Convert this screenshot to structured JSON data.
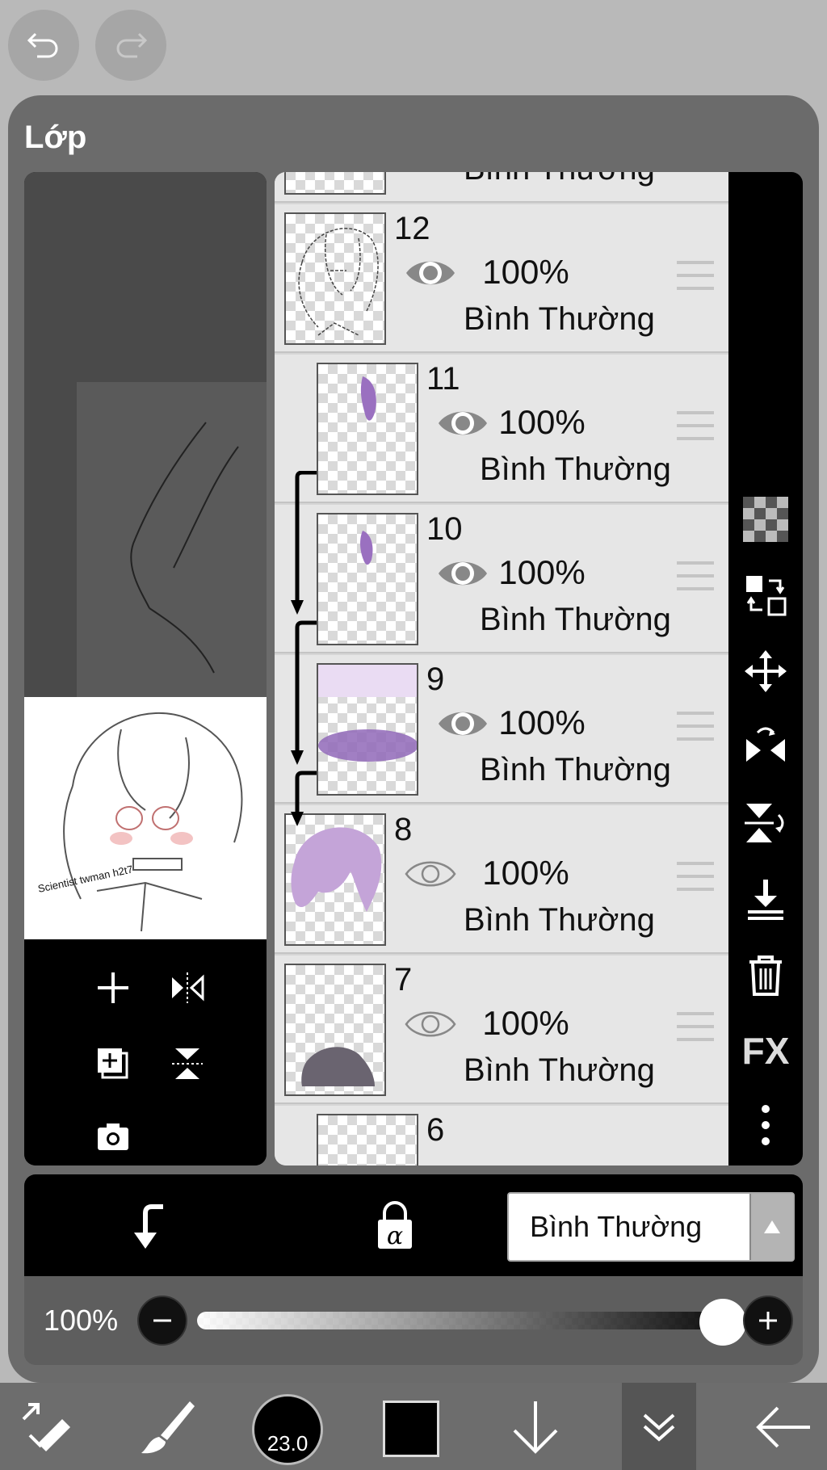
{
  "panel": {
    "title": "Lớp"
  },
  "thumbnail": {
    "signature": "Scientist twman h2t7"
  },
  "layers": [
    {
      "number": "",
      "opacity": "",
      "mode": "Bình Thường",
      "visible": true
    },
    {
      "number": "12",
      "opacity": "100%",
      "mode": "Bình Thường",
      "visible": true
    },
    {
      "number": "11",
      "opacity": "100%",
      "mode": "Bình Thường",
      "visible": true
    },
    {
      "number": "10",
      "opacity": "100%",
      "mode": "Bình Thường",
      "visible": true
    },
    {
      "number": "9",
      "opacity": "100%",
      "mode": "Bình Thường",
      "visible": true
    },
    {
      "number": "8",
      "opacity": "100%",
      "mode": "Bình Thường",
      "visible": false
    },
    {
      "number": "7",
      "opacity": "100%",
      "mode": "Bình Thường",
      "visible": false
    },
    {
      "number": "6",
      "opacity": "",
      "mode": "",
      "visible": false
    }
  ],
  "right_toolbar": {
    "fx_label": "FX"
  },
  "blend": {
    "selected": "Bình Thường"
  },
  "opacity": {
    "label": "100%",
    "value": 1.0
  },
  "bottom": {
    "brush_size": "23.0",
    "color": "#000000"
  }
}
